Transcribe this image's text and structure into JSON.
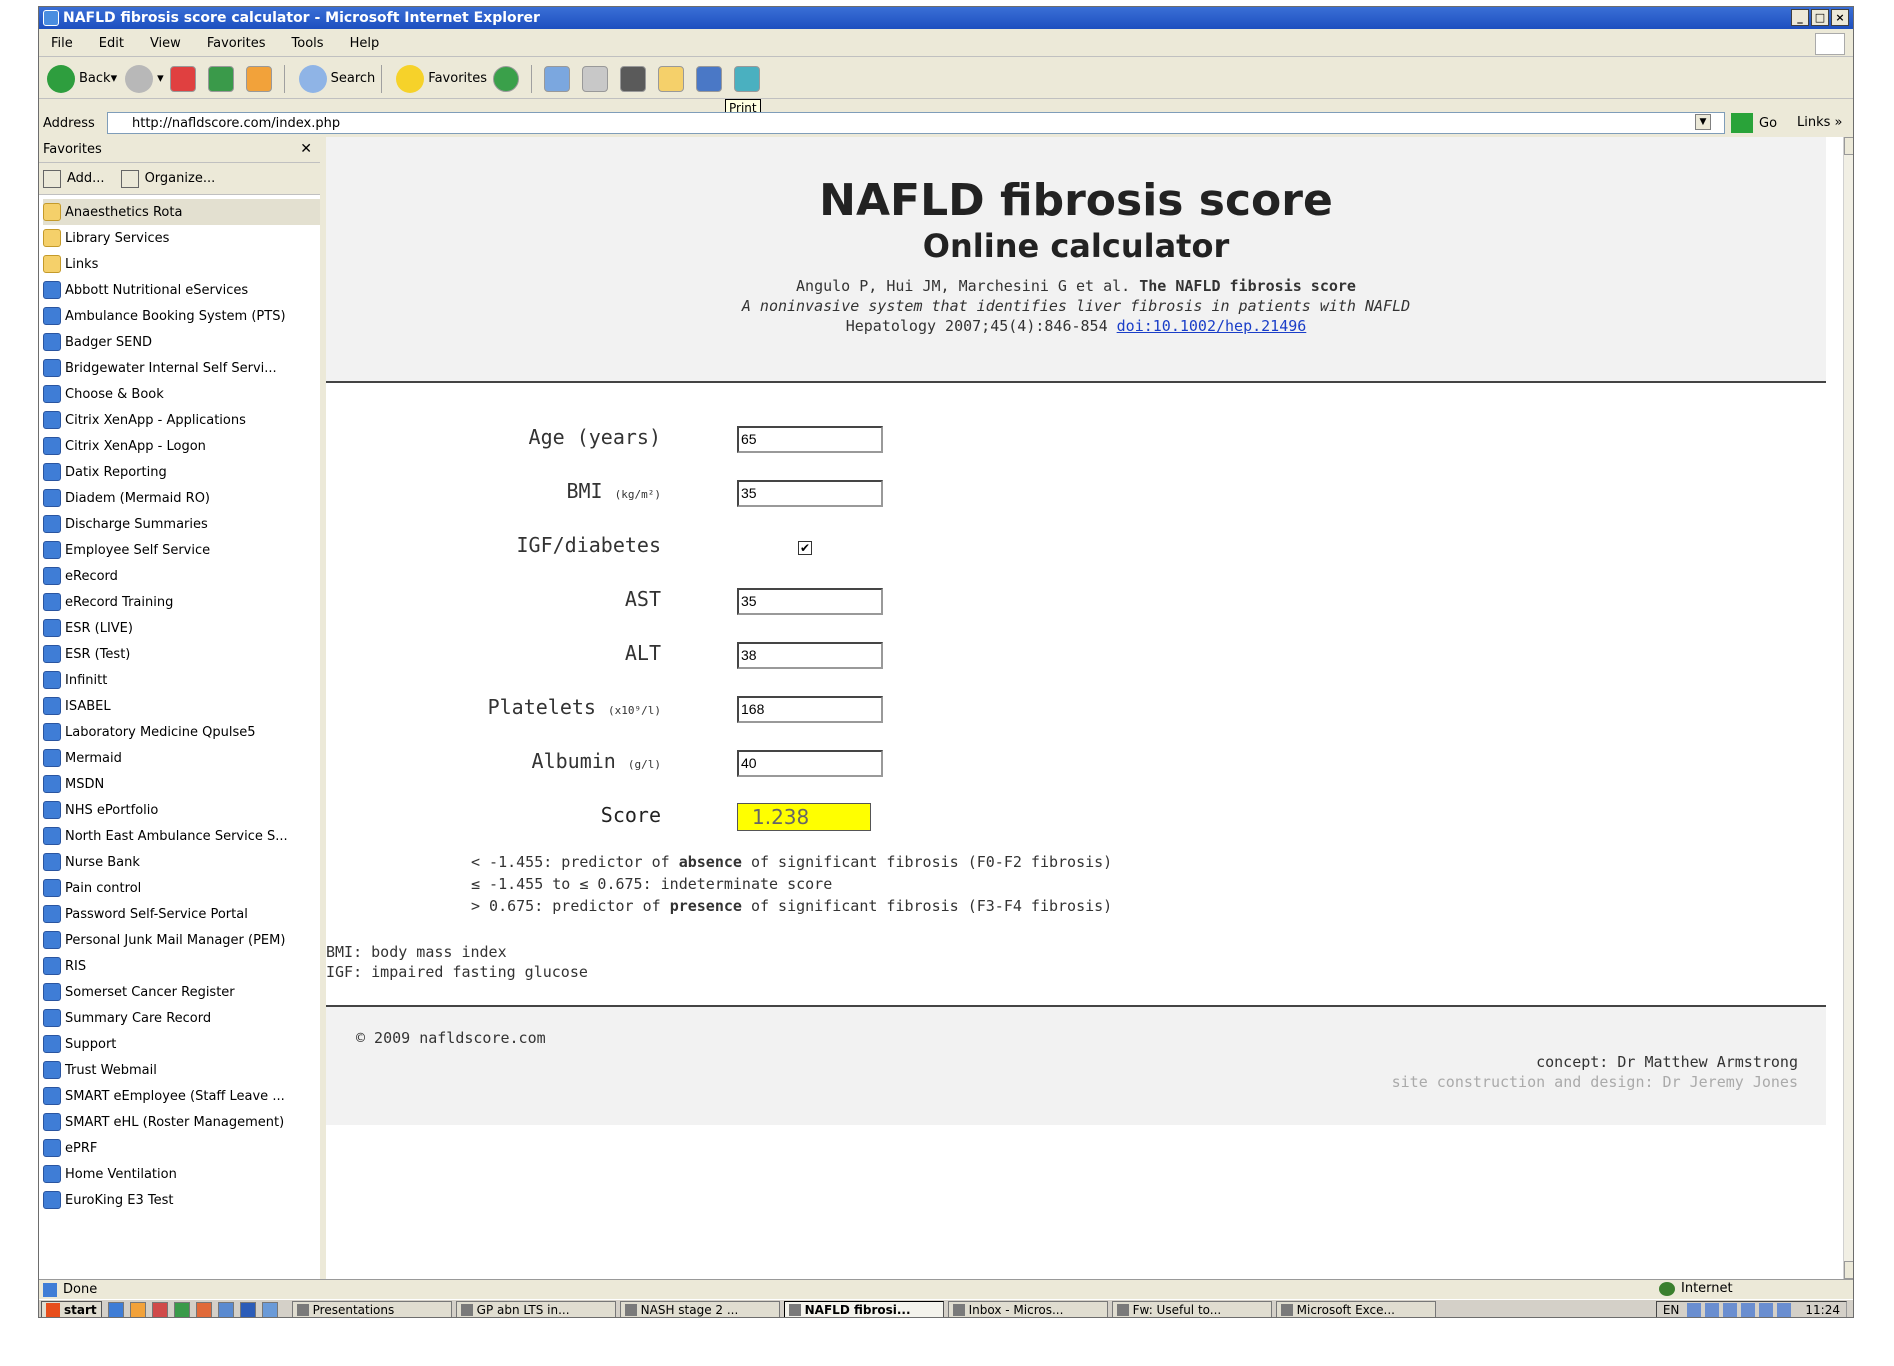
{
  "window": {
    "title": "NAFLD fibrosis score calculator - Microsoft Internet Explorer"
  },
  "menu": [
    "File",
    "Edit",
    "View",
    "Favorites",
    "Tools",
    "Help"
  ],
  "toolbar": {
    "back": "Back",
    "search": "Search",
    "favorites": "Favorites",
    "tooltip": "Print"
  },
  "address": {
    "label": "Address",
    "url": "http://nafldscore.com/index.php",
    "go": "Go",
    "links": "Links"
  },
  "favorites": {
    "header": "Favorites",
    "add": "Add...",
    "organize": "Organize...",
    "items": [
      "Anaesthetics Rota",
      "Library Services",
      "Links",
      "Abbott Nutritional eServices",
      "Ambulance Booking System (PTS)",
      "Badger SEND",
      "Bridgewater Internal Self Servi...",
      "Choose & Book",
      "Citrix XenApp - Applications",
      "Citrix XenApp - Logon",
      "Datix Reporting",
      "Diadem (Mermaid RO)",
      "Discharge Summaries",
      "Employee Self Service",
      "eRecord",
      "eRecord Training",
      "ESR (LIVE)",
      "ESR (Test)",
      "Infinitt",
      "ISABEL",
      "Laboratory Medicine Qpulse5",
      "Mermaid",
      "MSDN",
      "NHS ePortfolio",
      "North East Ambulance Service S...",
      "Nurse Bank",
      "Pain control",
      "Password Self-Service Portal",
      "Personal Junk Mail Manager (PEM)",
      "RIS",
      "Somerset Cancer Register",
      "Summary Care Record",
      "Support",
      "Trust Webmail",
      "SMART eEmployee (Staff Leave ...",
      "SMART eHL (Roster Management)",
      "ePRF",
      "Home Ventilation",
      "EuroKing E3 Test"
    ]
  },
  "page": {
    "title": "NAFLD fibrosis score",
    "subtitle": "Online calculator",
    "ref_authors": "Angulo P, Hui JM, Marchesini G et al.",
    "ref_title": "The NAFLD fibrosis score",
    "ref_subtitle": "A noninvasive system that identifies liver fibrosis in patients with NAFLD",
    "ref_journal": "Hepatology 2007;45(4):846-854",
    "ref_doi": "doi:10.1002/hep.21496",
    "form": {
      "age_label": "Age (years)",
      "age": "65",
      "bmi_label": "BMI",
      "bmi_unit": "(kg/m²)",
      "bmi": "35",
      "igf_label": "IGF/diabetes",
      "igf_checked": true,
      "ast_label": "AST",
      "ast": "35",
      "alt_label": "ALT",
      "alt": "38",
      "plt_label": "Platelets",
      "plt_unit": "(x10⁹/l)",
      "plt": "168",
      "alb_label": "Albumin",
      "alb_unit": "(g/l)",
      "alb": "40",
      "score_label": "Score",
      "score": "1.238"
    },
    "interp": [
      {
        "pre": "< -1.455: predictor of ",
        "bold": "absence",
        "post": " of significant fibrosis (F0-F2 fibrosis)"
      },
      {
        "pre": "≤ -1.455 to ≤ 0.675: indeterminate score",
        "bold": "",
        "post": ""
      },
      {
        "pre": "> 0.675: predictor of ",
        "bold": "presence",
        "post": " of significant fibrosis (F3-F4 fibrosis)"
      }
    ],
    "abbr_bmi": "BMI: body mass index",
    "abbr_igf": "IGF: impaired fasting glucose",
    "copyright": "© 2009 nafldscore.com",
    "concept": "concept: Dr Matthew Armstrong",
    "design": "site construction and design: Dr Jeremy Jones"
  },
  "status": {
    "text": "Done",
    "zone": "Internet"
  },
  "taskbar": {
    "start": "start",
    "tasks": [
      "Presentations",
      "GP abn LTS in...",
      "NASH stage 2 ...",
      "NAFLD fibrosi...",
      "Inbox - Micros...",
      "Fw: Useful to...",
      "Microsoft Exce..."
    ],
    "lang": "EN",
    "clock": "11:24"
  }
}
